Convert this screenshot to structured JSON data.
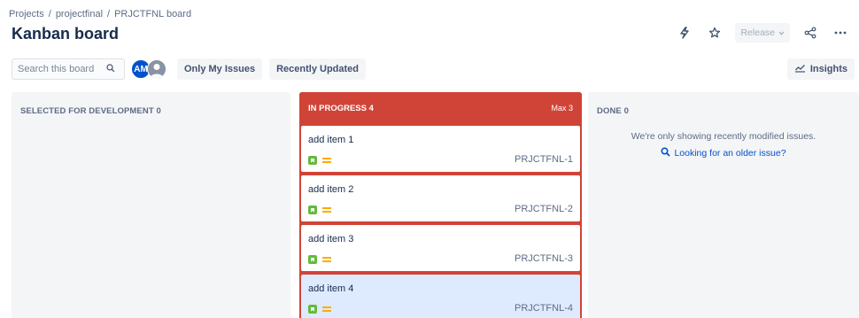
{
  "breadcrumb": {
    "items": [
      "Projects",
      "projectfinal",
      "PRJCTFNL board"
    ],
    "separator": "/"
  },
  "page": {
    "title": "Kanban board"
  },
  "header": {
    "release_label": "Release",
    "icons": [
      "lightning-icon",
      "star-icon",
      "share-icon",
      "more-icon"
    ]
  },
  "toolbar": {
    "search_placeholder": "Search this board",
    "avatar_initials": "AM",
    "filters": [
      "Only My Issues",
      "Recently Updated"
    ],
    "insights_label": "Insights"
  },
  "columns": [
    {
      "title": "SELECTED FOR DEVELOPMENT",
      "count": "0"
    },
    {
      "title": "IN PROGRESS",
      "count": "4",
      "max": "Max 3"
    },
    {
      "title": "DONE",
      "count": "0"
    }
  ],
  "cards": [
    {
      "summary": "add item 1",
      "key": "PRJCTFNL-1"
    },
    {
      "summary": "add item 2",
      "key": "PRJCTFNL-2"
    },
    {
      "summary": "add item 3",
      "key": "PRJCTFNL-3"
    },
    {
      "summary": "add item 4",
      "key": "PRJCTFNL-4"
    }
  ],
  "done": {
    "message": "We're only showing recently modified issues.",
    "link": "Looking for an older issue?"
  },
  "colors": {
    "accent_red": "#d04437",
    "story_green": "#63ba3c",
    "priority_yellow": "#ffab00",
    "link_blue": "#0052cc",
    "selected_card": "#deebff"
  }
}
